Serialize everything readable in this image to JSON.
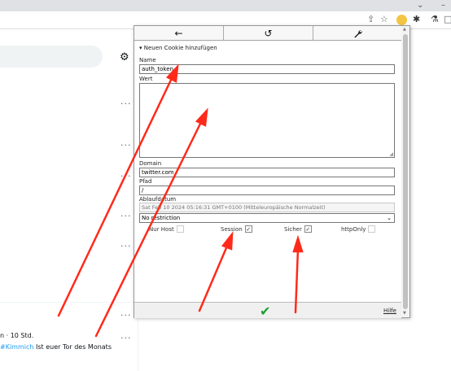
{
  "browser": {
    "toolbar_icons": [
      "share-icon",
      "star-icon",
      "extension-avatar-icon",
      "puzzle-icon",
      "flask-icon",
      "sidebar-icon"
    ]
  },
  "twitter": {
    "tweet_meta": "n · 10 Std.",
    "tweet_hashtag": "#Kimmich",
    "tweet_text": " Ist euer Tor des Monats"
  },
  "popup": {
    "header": {
      "back_icon": "←",
      "undo_icon": "↺",
      "settings_icon": "wrench-icon"
    },
    "section_title": "▾ Neuen Cookie hinzufügen",
    "fields": {
      "name_label": "Name",
      "name_value": "auth_token",
      "value_label": "Wert",
      "value_value": "",
      "domain_label": "Domain",
      "domain_value": "twitter.com",
      "path_label": "Pfad",
      "path_value": "/",
      "expiry_label": "Ablaufdatum",
      "expiry_value": "Sat Feb 10 2024 05:16:31 GMT+0100 (Mitteleuropäische Normalzeit)",
      "restriction_value": "No restriction"
    },
    "checkboxes": [
      {
        "label": "Nur Host",
        "checked": false
      },
      {
        "label": "Session",
        "checked": true
      },
      {
        "label": "Sicher",
        "checked": true
      },
      {
        "label": "httpOnly",
        "checked": false
      }
    ],
    "footer": {
      "confirm_icon": "✔",
      "help_label": "Hilfe"
    }
  },
  "colors": {
    "annotation_arrow": "#ff2a1a",
    "confirm_green": "#1e9e2e",
    "hashtag_blue": "#1d9bf0"
  }
}
